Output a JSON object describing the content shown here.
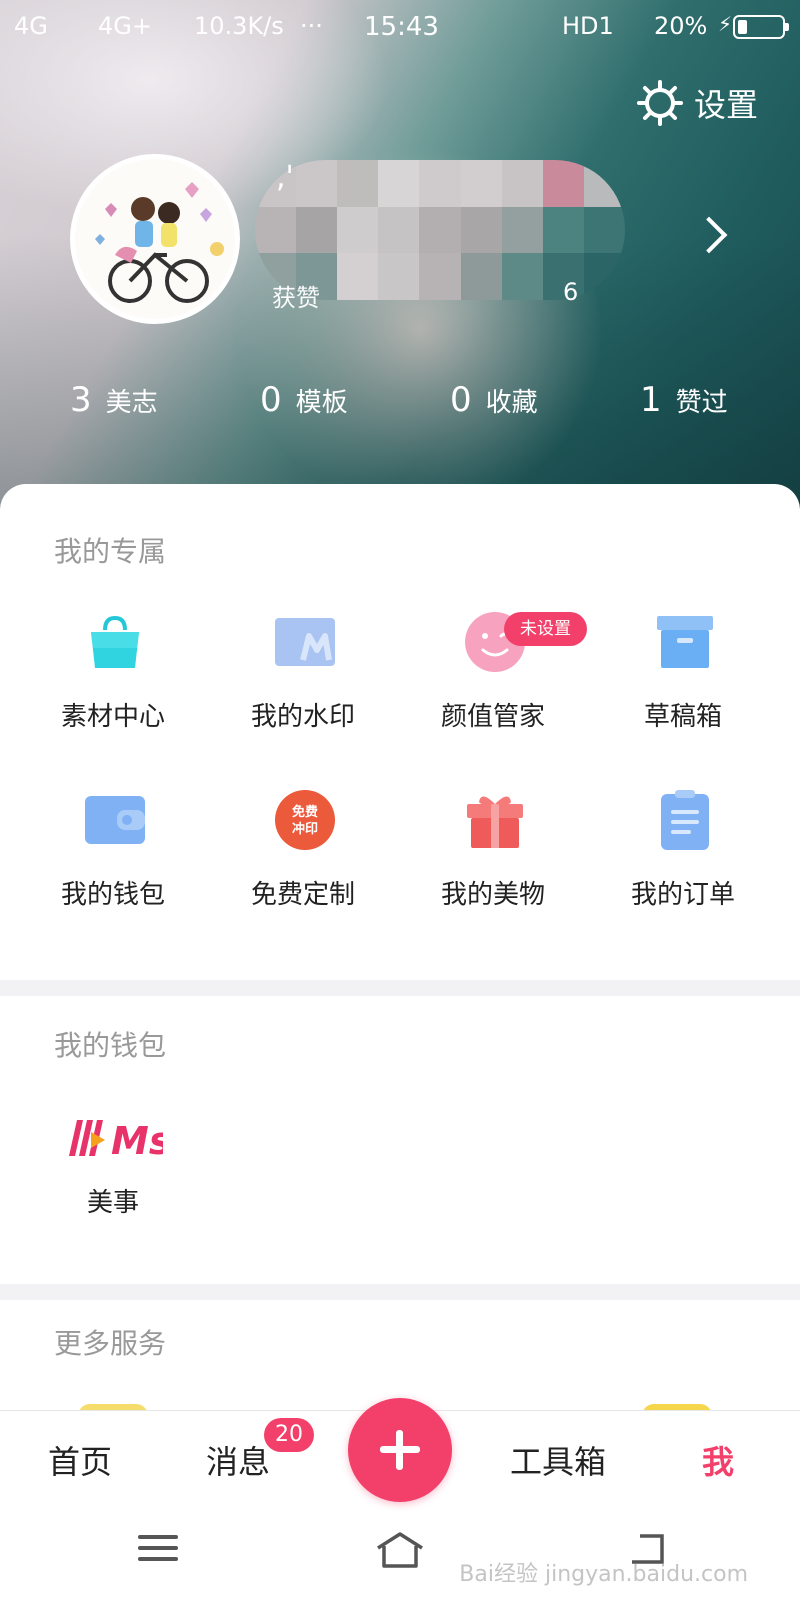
{
  "status_bar": {
    "network1": "4G",
    "network2": "4G+",
    "speed": "10.3K/s",
    "more": "···",
    "time": "15:43",
    "hd": "HD1",
    "battery": "20%"
  },
  "header": {
    "settings_label": "设置",
    "name_prefix": ",'",
    "likes_label": "获赞",
    "likes_tail": "6"
  },
  "stats": [
    {
      "count": "3",
      "label": "美志"
    },
    {
      "count": "0",
      "label": "模板"
    },
    {
      "count": "0",
      "label": "收藏"
    },
    {
      "count": "1",
      "label": "赞过"
    }
  ],
  "exclusive": {
    "title": "我的专属",
    "badge": "未设置",
    "items": [
      {
        "label": "素材中心",
        "icon": "bag-icon"
      },
      {
        "label": "我的水印",
        "icon": "watermark-icon"
      },
      {
        "label": "颜值管家",
        "icon": "smiley-icon"
      },
      {
        "label": "草稿箱",
        "icon": "box-icon"
      },
      {
        "label": "我的钱包",
        "icon": "wallet-icon"
      },
      {
        "label": "免费定制",
        "icon": "free-print-icon"
      },
      {
        "label": "我的美物",
        "icon": "gift-icon"
      },
      {
        "label": "我的订单",
        "icon": "clipboard-icon"
      }
    ],
    "free_print_text1": "免费",
    "free_print_text2": "冲印"
  },
  "wallet": {
    "title": "我的钱包",
    "item_label": "美事",
    "logo_text": "Ms"
  },
  "more": {
    "title": "更多服务"
  },
  "bottom_nav": {
    "home": "首页",
    "messages": "消息",
    "messages_badge": "20",
    "tools": "工具箱",
    "me": "我"
  },
  "watermark": "Bai经验 jingyan.baidu.com",
  "colors": {
    "accent": "#f2406a",
    "section_title": "#999999"
  }
}
